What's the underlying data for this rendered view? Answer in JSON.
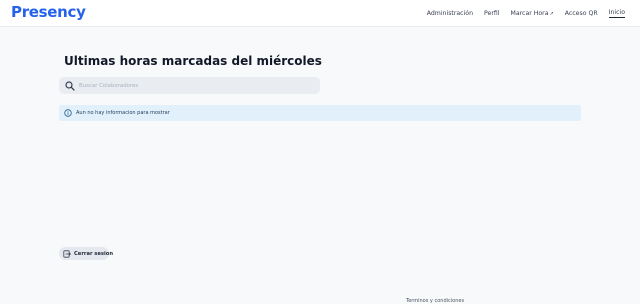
{
  "header": {
    "logo": "Presency",
    "nav": [
      {
        "label": "Administración"
      },
      {
        "label": "Perfil"
      },
      {
        "label": "Marcar Hora"
      },
      {
        "label": "Acceso QR"
      },
      {
        "label": "Inicio"
      }
    ],
    "external_icon": "external-link-icon"
  },
  "main": {
    "title": "Ultimas horas marcadas del miércoles",
    "search": {
      "placeholder": "Buscar Colaboradores",
      "value": "",
      "icon": "search-icon"
    },
    "alert": {
      "text": "Aun no hay informacion para mostrar",
      "icon": "info-icon"
    },
    "logout": {
      "label": "Cerrar sesion",
      "icon": "logout-icon"
    }
  },
  "footer": {
    "link": "Terminos y condiciones"
  },
  "colors": {
    "brand": "#2563eb",
    "alert_bg": "#e1f0fa",
    "search_bg": "#e9edf2"
  }
}
